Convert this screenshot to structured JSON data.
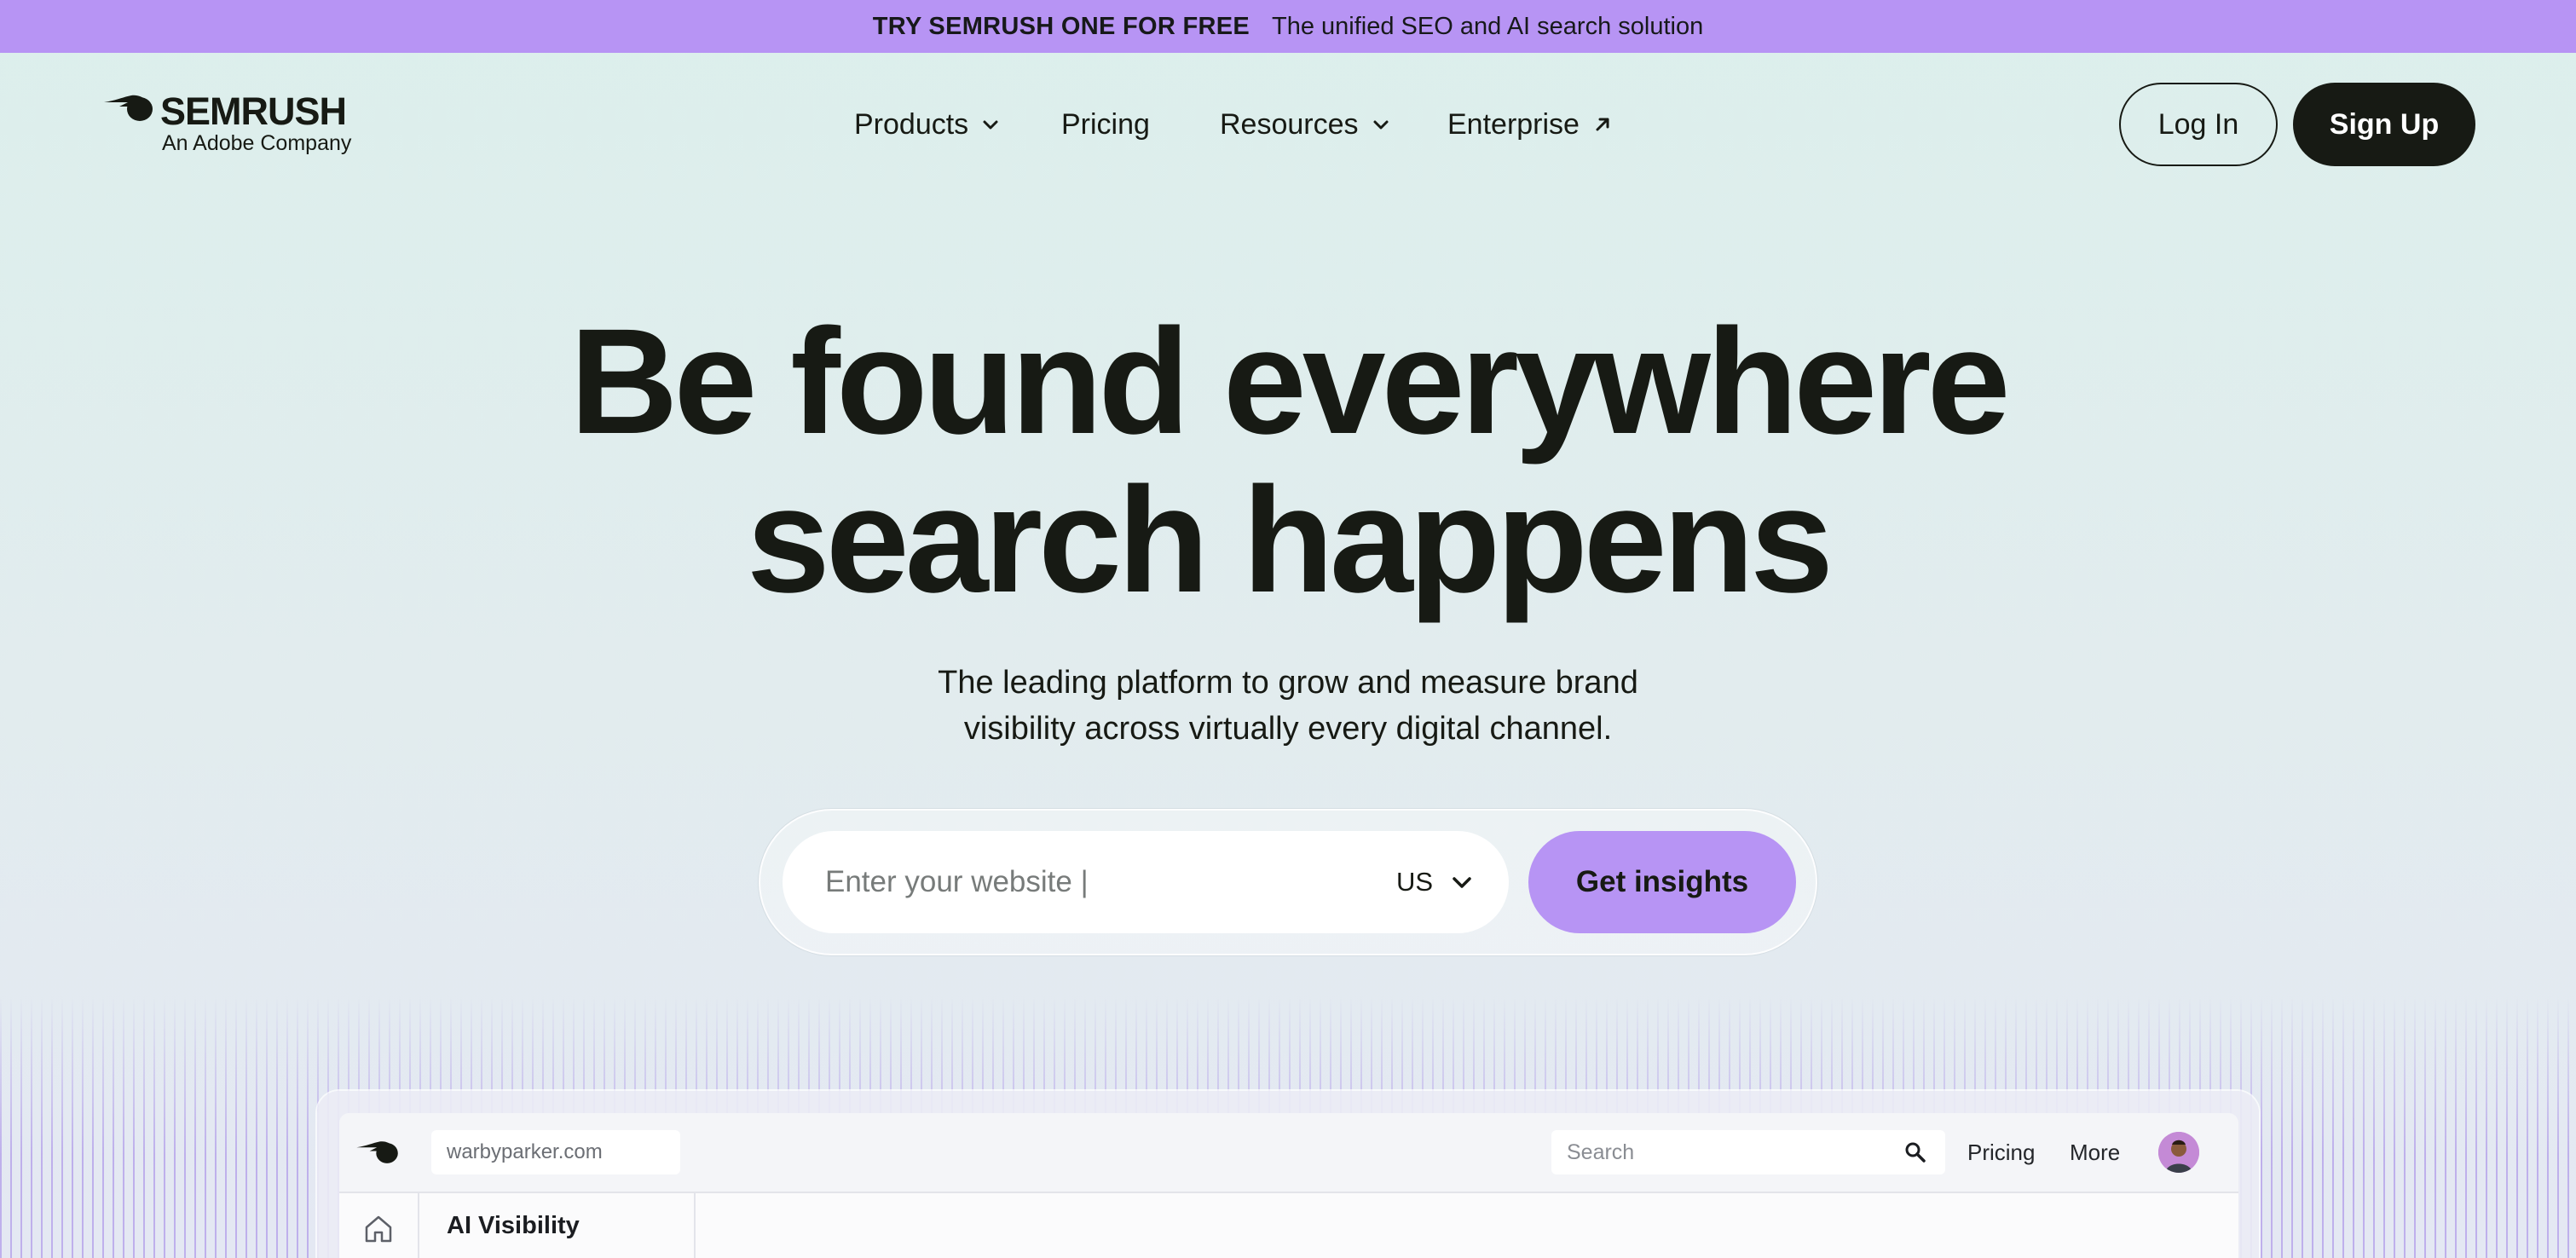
{
  "promo": {
    "strong": "TRY SEMRUSH ONE FOR FREE",
    "text": "The unified SEO and AI search solution"
  },
  "header": {
    "logo_name": "SEMRUSH",
    "logo_tagline": "An Adobe Company",
    "nav": {
      "products": "Products",
      "pricing": "Pricing",
      "resources": "Resources",
      "enterprise": "Enterprise"
    },
    "login": "Log In",
    "signup": "Sign Up"
  },
  "hero": {
    "title_line1": "Be found everywhere",
    "title_line2": "search happens",
    "subtitle_line1": "The leading platform to grow and measure brand",
    "subtitle_line2": "visibility across virtually every digital channel."
  },
  "search_form": {
    "placeholder": "Enter your website |",
    "country": "US",
    "submit": "Get insights"
  },
  "preview": {
    "domain": "warbyparker.com",
    "search_placeholder": "Search",
    "pricing": "Pricing",
    "more": "More",
    "section_title": "AI Visibility"
  },
  "icons": {
    "logo": "semrush-fireball-icon",
    "products_chevron": "chevron-down-icon",
    "resources_chevron": "chevron-down-icon",
    "enterprise_arrow": "arrow-up-right-icon",
    "country_chevron": "chevron-down-icon",
    "preview_search": "search-icon",
    "preview_home": "home-icon"
  },
  "colors": {
    "promo_bg": "#b794f4",
    "accent": "#b794f4",
    "dark": "#171a14",
    "page_bg": "#dcefec"
  }
}
